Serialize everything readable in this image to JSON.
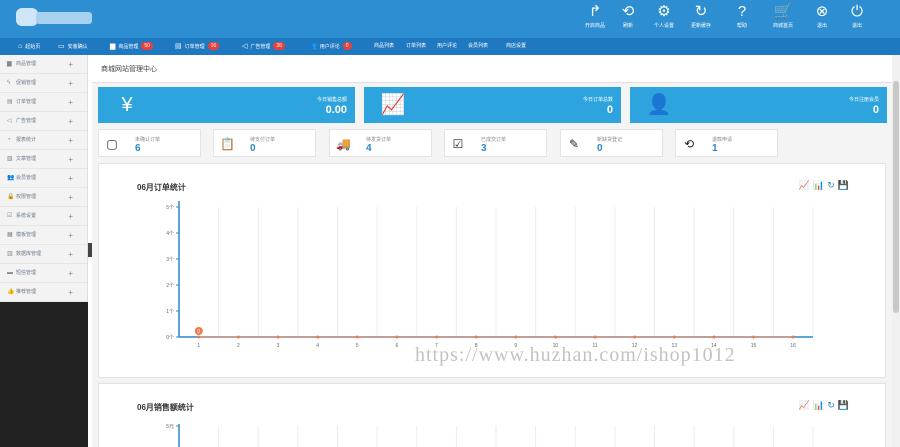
{
  "colors": {
    "header": "#2d8ed1",
    "nav": "#1f79c0",
    "stat_card": "#2ea4df",
    "chart_axis": "#2a88c8",
    "point": "#f07a4c",
    "badge": "#e8413a"
  },
  "toolbar": [
    {
      "icon": "share-arrow-icon",
      "glyph": "↱",
      "label": "开启商品"
    },
    {
      "icon": "refresh-arrows-icon",
      "glyph": "⟲",
      "label": "刷新"
    },
    {
      "icon": "gear-icon",
      "glyph": "⚙",
      "label": "个人设置"
    },
    {
      "icon": "clear-cache-icon",
      "glyph": "↻",
      "label": "更新缓存"
    },
    {
      "icon": "help-icon",
      "glyph": "?",
      "label": "帮助"
    },
    {
      "icon": "cart-icon",
      "glyph": "🛒",
      "label": "商城首页"
    },
    {
      "icon": "close-circle-icon",
      "glyph": "⊗",
      "label": "退出"
    },
    {
      "icon": "power-icon",
      "glyph": "⏻",
      "label": "退出"
    }
  ],
  "nav": [
    {
      "icon": "home-icon",
      "glyph": "⌂",
      "label": "起始页"
    },
    {
      "icon": "monitor-icon",
      "glyph": "▭",
      "label": "安装确认"
    },
    {
      "icon": "folder-icon",
      "glyph": "▆",
      "label": "商品管理",
      "badge": "50"
    },
    {
      "icon": "clipboard-icon",
      "glyph": "▤",
      "label": "订单管理",
      "badge": "16"
    },
    {
      "icon": "megaphone-icon",
      "glyph": "◁",
      "label": "广告管理",
      "badge": "26"
    },
    {
      "icon": "users-icon",
      "glyph": "👥",
      "label": "用户评论",
      "badge": "0"
    },
    {
      "label": "商品列表"
    },
    {
      "label": "订单列表"
    },
    {
      "label": "用户评论"
    },
    {
      "label": "会员列表"
    },
    {
      "label": "商店设置"
    }
  ],
  "sidebar": [
    {
      "icon": "folder-icon",
      "glyph": "▆",
      "label": "商品管理"
    },
    {
      "icon": "bolt-icon",
      "glyph": "ϟ",
      "label": "促销管理"
    },
    {
      "icon": "clipboard-icon",
      "glyph": "▤",
      "label": "订单管理"
    },
    {
      "icon": "megaphone-icon",
      "glyph": "◁",
      "label": "广告管理"
    },
    {
      "icon": "chart-pie-icon",
      "glyph": "◔",
      "label": "报表统计"
    },
    {
      "icon": "article-icon",
      "glyph": "▧",
      "label": "文章管理"
    },
    {
      "icon": "users-icon",
      "glyph": "👥",
      "label": "会员管理"
    },
    {
      "icon": "lock-icon",
      "glyph": "🔒",
      "label": "权限管理"
    },
    {
      "icon": "settings-icon",
      "glyph": "☑",
      "label": "系统设置"
    },
    {
      "icon": "template-icon",
      "glyph": "▦",
      "label": "模板管理"
    },
    {
      "icon": "database-icon",
      "glyph": "▥",
      "label": "数据库管理"
    },
    {
      "icon": "sms-icon",
      "glyph": "▬",
      "label": "短信管理"
    },
    {
      "icon": "thumbs-up-icon",
      "glyph": "👍",
      "label": "推荐管理"
    }
  ],
  "breadcrumb": "商城网站管理中心",
  "stats": [
    {
      "icon": "yen-icon",
      "glyph": "¥",
      "label": "今日销售总额",
      "value": "0.00"
    },
    {
      "icon": "growth-chart-icon",
      "glyph": "📈",
      "label": "今日订单总数",
      "value": "0"
    },
    {
      "icon": "member-card-icon",
      "glyph": "👤",
      "label": "今日注册会员",
      "value": "0"
    }
  ],
  "cards": [
    {
      "icon": "square-icon",
      "glyph": "▢",
      "label": "未确认订单",
      "value": "6"
    },
    {
      "icon": "clipboard-money-icon",
      "glyph": "📋",
      "label": "待支付订单",
      "value": "0"
    },
    {
      "icon": "truck-icon",
      "glyph": "🚚",
      "label": "待发货订单",
      "value": "4"
    },
    {
      "icon": "checklist-icon",
      "glyph": "☑",
      "label": "已成交订单",
      "value": "3"
    },
    {
      "icon": "edit-icon",
      "glyph": "✎",
      "label": "新缺货登记",
      "value": "0"
    },
    {
      "icon": "refund-icon",
      "glyph": "⟲",
      "label": "退款申请",
      "value": "1"
    }
  ],
  "panel_tools": [
    {
      "icon": "line-chart-icon",
      "glyph": "📈"
    },
    {
      "icon": "bar-chart-icon",
      "glyph": "📊"
    },
    {
      "icon": "refresh-icon",
      "glyph": "↻"
    },
    {
      "icon": "save-image-icon",
      "glyph": "💾"
    }
  ],
  "chart_data": [
    {
      "type": "line",
      "title": "06月订单统计",
      "x": [
        1,
        2,
        3,
        4,
        5,
        6,
        7,
        8,
        9,
        10,
        11,
        12,
        13,
        14,
        15,
        16
      ],
      "series": [
        {
          "values": [
            0,
            0,
            0,
            0,
            0,
            0,
            0,
            0,
            0,
            0,
            0,
            0,
            0,
            0,
            0,
            0
          ]
        }
      ],
      "marked_point": {
        "x": 1,
        "y": 0,
        "label": "0"
      },
      "yticks": [
        "0个",
        "1个",
        "2个",
        "3个",
        "4个",
        "5个"
      ],
      "ylim": [
        0,
        5
      ],
      "grid": true
    },
    {
      "type": "line",
      "title": "06月销售额统计",
      "yticks": [
        "5元"
      ]
    }
  ],
  "watermark": "https://www.huzhan.com/ishop1012"
}
